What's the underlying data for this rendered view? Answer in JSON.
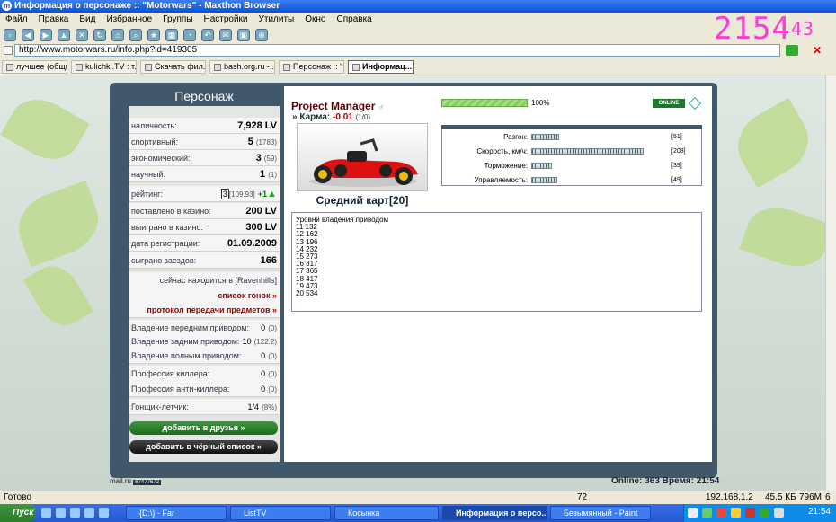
{
  "window": {
    "title": "Информация о персонаже :: \"Motorwars\" - Maxthon Browser"
  },
  "overlay_clock": {
    "main": "2154",
    "sup": "43"
  },
  "menu": [
    "Файл",
    "Правка",
    "Вид",
    "Избранное",
    "Группы",
    "Настройки",
    "Утилиты",
    "Окно",
    "Справка"
  ],
  "address": {
    "url": "http://www.motorwars.ru/info.php?id=419305"
  },
  "tabs": [
    {
      "label": "лучшее (общн..."
    },
    {
      "label": "kulichki.TV : т..."
    },
    {
      "label": "Скачать фил..."
    },
    {
      "label": "bash.org.ru -..."
    },
    {
      "label": "Персонаж :: \"..."
    },
    {
      "label": "Информац..."
    }
  ],
  "left": {
    "title": "Персонаж",
    "cash": {
      "label": "наличность:",
      "value": "7,928 LV"
    },
    "sport": {
      "label": "спортивный:",
      "value": "5",
      "extra": "(1783)"
    },
    "econ": {
      "label": "экономический:",
      "value": "3",
      "extra": "(59)"
    },
    "sci": {
      "label": "научный:",
      "value": "1",
      "extra": "(1)"
    },
    "rating": {
      "label": "рейтинг:",
      "value": "3",
      "extra": "[109.93]",
      "plus": "+1"
    },
    "bet": {
      "label": "поставлено в казино:",
      "value": "200 LV"
    },
    "won": {
      "label": "выиграно в казино:",
      "value": "300 LV"
    },
    "reg": {
      "label": "дата регистрации:",
      "value": "01.09.2009"
    },
    "races": {
      "label": "сыграно заездов:",
      "value": "166"
    },
    "location": "сейчас находится в [Ravenhills]",
    "race_list": "список гонок »",
    "transfer_log": "протокол передачи предметов »",
    "fwd": {
      "label": "Владение передним приводом:",
      "value": "0",
      "extra": "(0)"
    },
    "rwd": {
      "label": "Владение задним приводом:",
      "value": "10",
      "extra": "(122.2)"
    },
    "awd": {
      "label": "Владение полным приводом:",
      "value": "0",
      "extra": "(0)"
    },
    "killer": {
      "label": "Профессия киллера:",
      "value": "0",
      "extra": "(0)"
    },
    "antikiller": {
      "label": "Профессия анти-киллера:",
      "value": "0",
      "extra": "(0)"
    },
    "pilot": {
      "label": "Гонщик-летчик:",
      "value": "1/4",
      "extra": "(8%)"
    },
    "add_friend": "добавить в друзья »",
    "add_black": "добавить в чёрный список »"
  },
  "profile": {
    "name": "Project Manager",
    "gender": "♂",
    "karma_label": "» Карма:",
    "karma_value": "-0.01",
    "karma_count": "(1/0)",
    "progress_pct": 100,
    "progress_label": "100%",
    "online": "ONLINE",
    "cart_name": "Средний карт[20]"
  },
  "stats": [
    {
      "label": "Разгон:",
      "value": "[51]",
      "level": 51
    },
    {
      "label": "Скорость, км/ч:",
      "value": "[208]",
      "level": 208
    },
    {
      "label": "Торможение:",
      "value": "[39]",
      "level": 39
    },
    {
      "label": "Управляемость:",
      "value": "[49]",
      "level": 49
    }
  ],
  "levels": {
    "title": "Уровни владения приводом",
    "rows": [
      "11 132",
      "12 162",
      "13 196",
      "14 232",
      "15 273",
      "16 317",
      "17 365",
      "18 417",
      "19 473",
      "20 534"
    ]
  },
  "footer": {
    "online": "Online: 363  Время: 21:54",
    "logo": "mail.ru",
    "counter": "67477672"
  },
  "status": {
    "left": "Готово",
    "count": "72",
    "ip": "192.168.1.2",
    "size": "45,5 КБ",
    "mem": "796М",
    "num": "6"
  },
  "taskbar": {
    "start": "Пуск",
    "items": [
      {
        "label": "{D:\\} - Far"
      },
      {
        "label": "ListTV"
      },
      {
        "label": "Косынка"
      },
      {
        "label": "Информация о персо..."
      },
      {
        "label": "Безымянный - Paint"
      }
    ],
    "clock": "21:54"
  }
}
